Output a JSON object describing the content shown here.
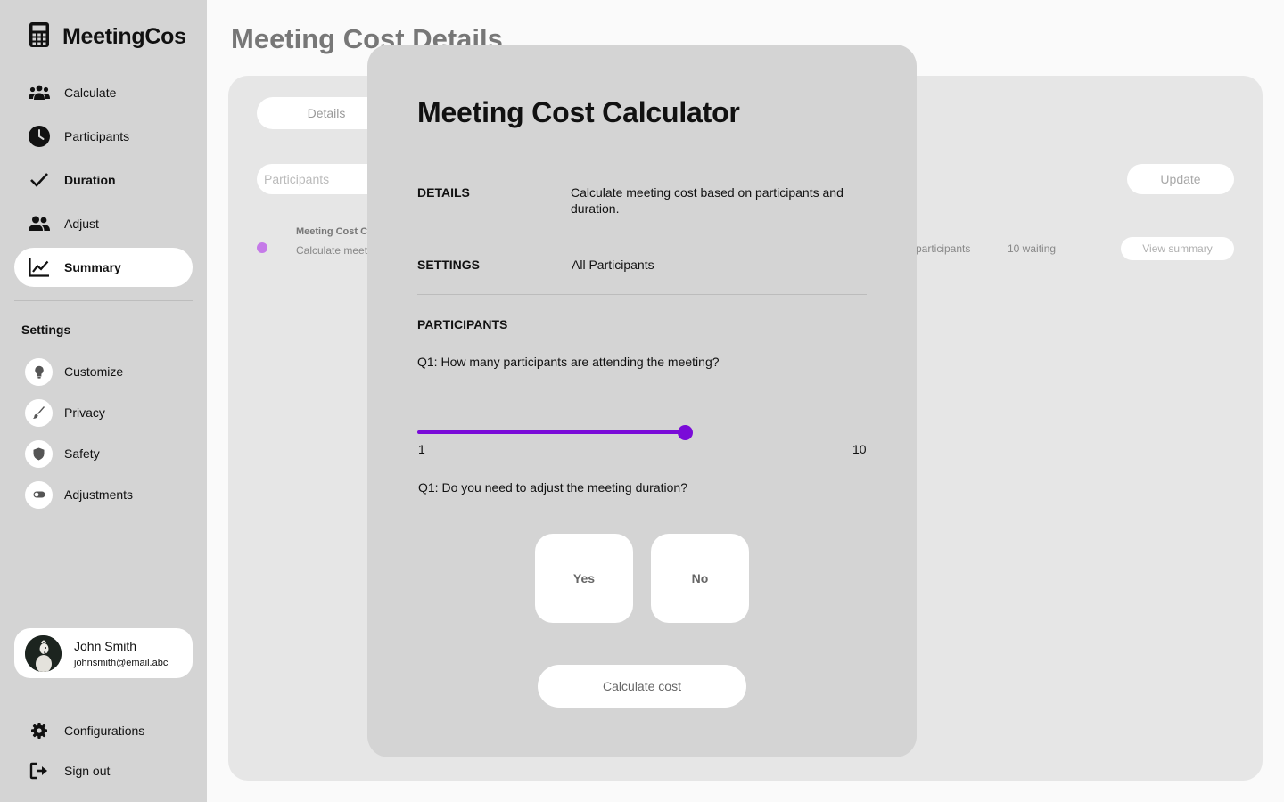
{
  "app": {
    "name": "MeetingCos"
  },
  "sidebar": {
    "nav": [
      {
        "label": "Calculate",
        "icon": "group-icon"
      },
      {
        "label": "Participants",
        "icon": "clock-icon"
      },
      {
        "label": "Duration",
        "icon": "check-icon"
      },
      {
        "label": "Adjust",
        "icon": "people-icon"
      },
      {
        "label": "Summary",
        "icon": "chart-line-icon",
        "active": true
      }
    ],
    "settings_title": "Settings",
    "settings": [
      {
        "label": "Customize",
        "icon": "bulb-icon"
      },
      {
        "label": "Privacy",
        "icon": "brush-icon"
      },
      {
        "label": "Safety",
        "icon": "shield-icon"
      },
      {
        "label": "Adjustments",
        "icon": "toggle-icon"
      }
    ],
    "user": {
      "name": "John Smith",
      "email": "johnsmith@email.abc"
    },
    "bottom": [
      {
        "label": "Configurations",
        "icon": "gear-icon"
      },
      {
        "label": "Sign out",
        "icon": "sign-out-icon"
      }
    ]
  },
  "main": {
    "title": "Meeting Cost Details",
    "tab": "Details",
    "search_placeholder": "Participants",
    "update_label": "Update",
    "row": {
      "title": "Meeting Cost C",
      "subtitle": "Calculate meet",
      "participants": "participants",
      "waiting": "10 waiting",
      "action": "View summary"
    }
  },
  "modal": {
    "title": "Meeting Cost Calculator",
    "details_label": "DETAILS",
    "details_text": "Calculate meeting cost based on participants and duration.",
    "settings_label": "SETTINGS",
    "settings_value": "All Participants",
    "participants_label": "PARTICIPANTS",
    "q1": "Q1: How many participants are attending the meeting?",
    "slider": {
      "min": "1",
      "max": "10",
      "value": 0.6,
      "color": "#7a0bd8"
    },
    "q2": "Q1: Do you need to adjust the meeting duration?",
    "yes_label": "Yes",
    "no_label": "No",
    "calculate_label": "Calculate cost"
  }
}
